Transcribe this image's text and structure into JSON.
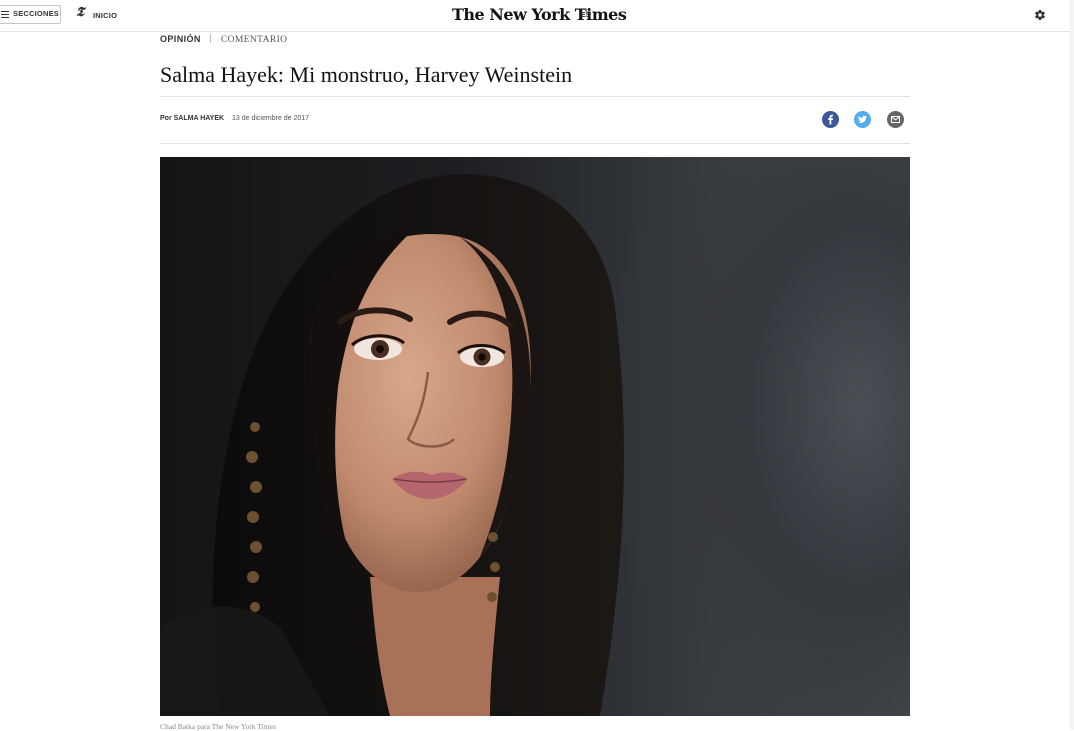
{
  "topbar": {
    "sections_label": "SECCIONES",
    "home_label": "INICIO",
    "home_icon_glyph": "𝕿",
    "logo": "The New York Times",
    "edition": "ES"
  },
  "article": {
    "section": "OPINIÓN",
    "type": "COMENTARIO",
    "headline": "Salma Hayek: Mi monstruo, Harvey Weinstein",
    "byline_prefix": "Por",
    "author": "SALMA HAYEK",
    "date": "13 de diciembre de 2017",
    "photo_credit": "Chad Batka para The New York Times"
  },
  "share": [
    "facebook-icon",
    "twitter-icon",
    "email-icon"
  ],
  "colors": {
    "facebook": "#3b5998",
    "twitter": "#55acee",
    "email": "#666666"
  }
}
